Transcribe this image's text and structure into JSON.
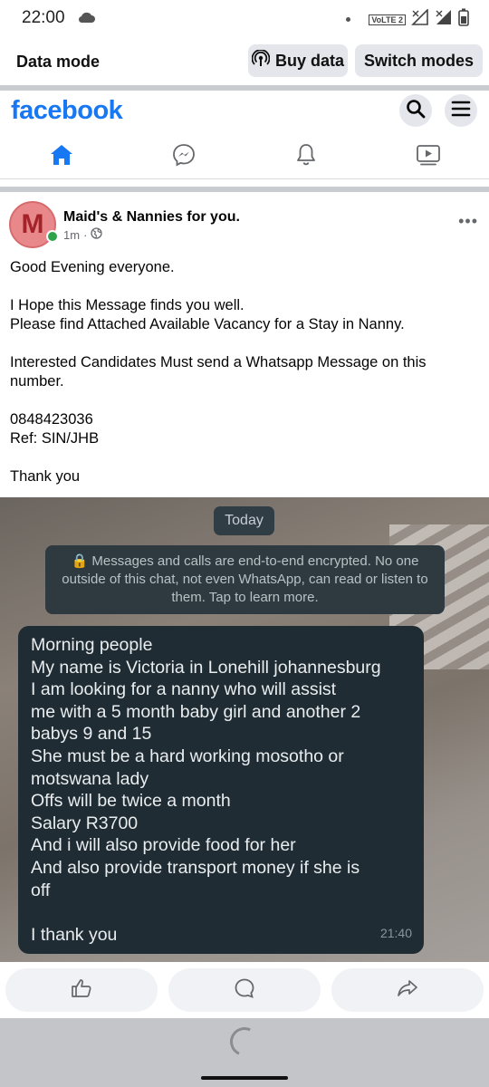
{
  "status_bar": {
    "time": "22:00",
    "network_badge": "VoLTE 2",
    "icons": [
      "cloud-icon",
      "dot-icon",
      "volte-icon",
      "signal-icon",
      "signal-icon",
      "battery-icon"
    ]
  },
  "data_mode_bar": {
    "label": "Data mode",
    "buy_label": "Buy data",
    "switch_label": "Switch modes"
  },
  "header": {
    "logo": "facebook",
    "icons": [
      "search-icon",
      "menu-icon"
    ]
  },
  "tabs": [
    {
      "icon": "home-icon",
      "active": true
    },
    {
      "icon": "messenger-icon",
      "active": false
    },
    {
      "icon": "bell-icon",
      "active": false
    },
    {
      "icon": "video-icon",
      "active": false
    }
  ],
  "post": {
    "avatar_letter": "M",
    "author": "Maid's & Nannies for you.",
    "time": "1m",
    "separator": "·",
    "privacy_icon": "globe-icon",
    "more": "•••",
    "paragraphs": [
      "Good Evening everyone.",
      "I Hope this Message finds you well.\nPlease find Attached Available Vacancy for a Stay in Nanny.",
      "Interested Candidates Must send a Whatsapp Message on this number.",
      "0848423036\nRef: SIN/JHB",
      "Thank you"
    ],
    "photo": {
      "date_chip": "Today",
      "encryption_notice": "🔒 Messages and calls are end-to-end encrypted. No one outside of this chat, not even WhatsApp, can read or listen to them. Tap to learn more.",
      "message_lines": [
        "Morning people",
        "My name is Victoria in Lonehill johannesburg",
        "I am looking for a nanny who will assist",
        "me with a 5 month baby girl and another 2",
        "babys 9 and 15",
        "She must be a hard working mosotho or",
        "motswana lady",
        "Offs will be twice a month",
        "Salary R3700",
        "And i will also provide food for her",
        "And also provide transport money if she is",
        "off",
        "",
        "I thank you"
      ],
      "message_time": "21:40"
    }
  },
  "actions": [
    "like-icon",
    "comment-icon",
    "share-icon"
  ],
  "colors": {
    "brand": "#1877f2",
    "bubble": "#1f2c33",
    "online": "#31a24c"
  }
}
